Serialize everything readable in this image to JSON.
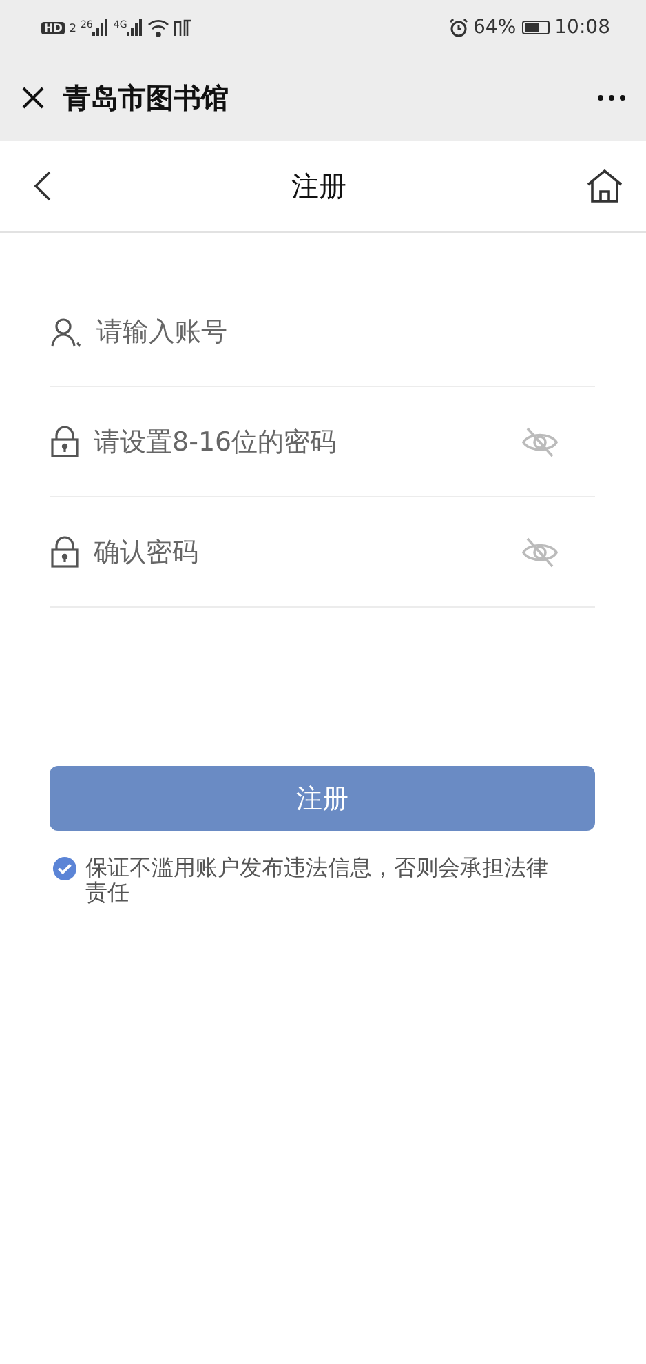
{
  "status_bar": {
    "hd": "HD",
    "sim": "2",
    "networks": [
      "26",
      "4G"
    ],
    "battery_percent": "64%",
    "time": "10:08"
  },
  "window": {
    "title": "青岛市图书馆"
  },
  "nav": {
    "title": "注册"
  },
  "fields": [
    {
      "kind": "account",
      "placeholder": "请输入账号"
    },
    {
      "kind": "password",
      "placeholder": "请设置8-16位的密码",
      "revealed": false
    },
    {
      "kind": "password",
      "placeholder": "确认密码",
      "revealed": false
    }
  ],
  "submit": {
    "label": "注册"
  },
  "agreement": {
    "checked": true,
    "text": "保证不滥用账户发布违法信息，否则会承担法律责任"
  }
}
